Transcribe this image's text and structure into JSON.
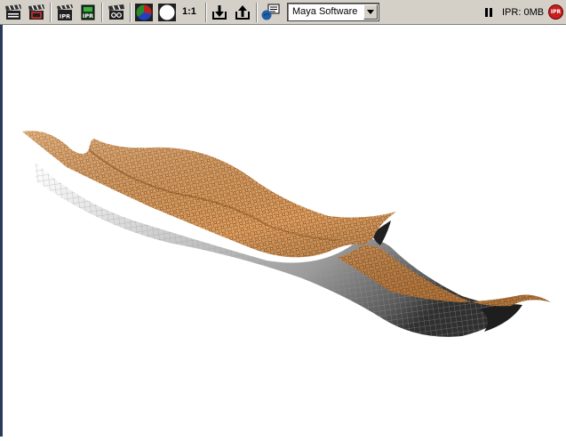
{
  "toolbar": {
    "ratio_label": "1:1",
    "renderer": {
      "selected": "Maya Software"
    },
    "ipr_status": "IPR: 0MB",
    "stop_ipr_label": "IPR"
  },
  "icons": {
    "redo_render": "clapper-icon",
    "render_region": "clapper-region-icon",
    "redo_ipr": "ipr-clapper-icon",
    "refresh_ipr": "ipr-refresh-icon",
    "snapshot": "snapshot-icon",
    "rgb": "rgb-channel-icon",
    "alpha": "alpha-channel-icon",
    "keep_image": "keep-image-icon",
    "remove_image": "remove-image-icon",
    "render_settings": "render-settings-icon",
    "pause": "pause-icon"
  },
  "colors": {
    "toolbar_bg": "#d4d0c8",
    "viewport_bg": "#ffffff",
    "ipr_stop": "#c81e1e",
    "surface_texture": "#c88a4e"
  }
}
